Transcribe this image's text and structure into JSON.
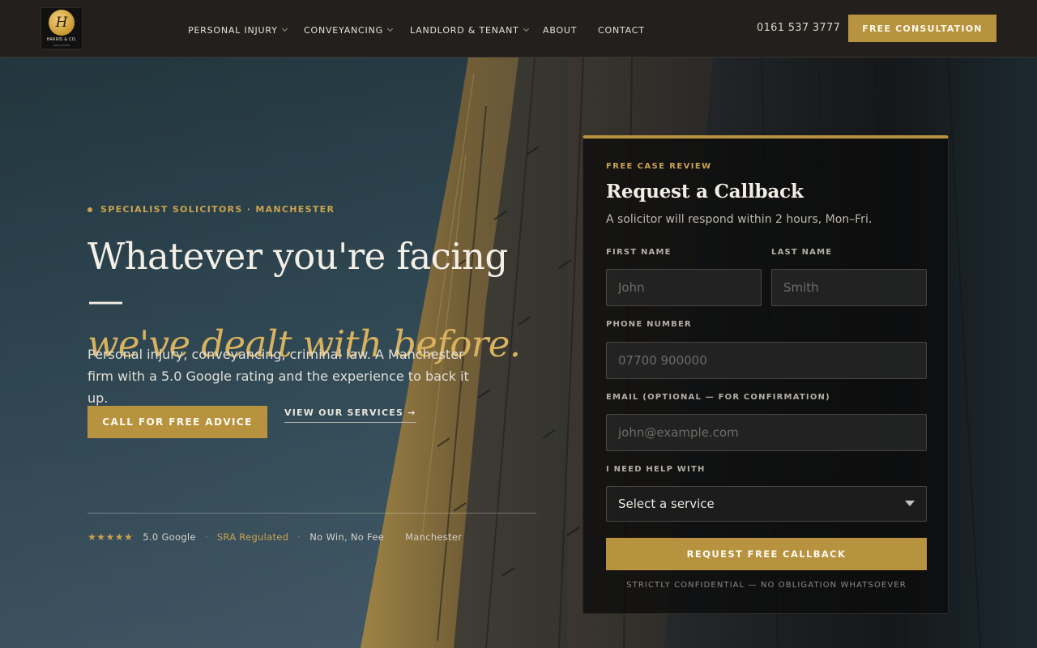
{
  "header": {
    "logo": {
      "monogram": "H",
      "name": "HARRIS & CO.",
      "tagline": "SOLICITORS"
    },
    "nav": [
      {
        "label": "PERSONAL INJURY",
        "has_dropdown": true
      },
      {
        "label": "CONVEYANCING",
        "has_dropdown": true
      },
      {
        "label": "LANDLORD & TENANT",
        "has_dropdown": true
      },
      {
        "label": "ABOUT",
        "has_dropdown": false
      },
      {
        "label": "CONTACT",
        "has_dropdown": false
      }
    ],
    "phone": "0161 537 3777",
    "cta_label": "FREE CONSULTATION"
  },
  "hero": {
    "eyebrow": "SPECIALIST SOLICITORS · MANCHESTER",
    "headline_line1": "Whatever you're facing —",
    "headline_line2": "we've dealt with before.",
    "lede": "Personal injury, conveyancing, criminal law. A Manchester firm with a 5.0 Google rating and the experience to back it up.",
    "primary_cta": "CALL FOR FREE ADVICE",
    "secondary_cta": "VIEW OUR SERVICES →",
    "trust": {
      "stars": "★★★★★",
      "rating": "5.0 Google",
      "regulated": "SRA Regulated",
      "fee": "No Win, No Fee",
      "location": "Manchester",
      "separator": "·"
    }
  },
  "form": {
    "eyebrow": "FREE CASE REVIEW",
    "title": "Request a Callback",
    "subtitle": "A solicitor will respond within 2 hours, Mon–Fri.",
    "first_name": {
      "label": "FIRST NAME",
      "placeholder": "John",
      "value": ""
    },
    "last_name": {
      "label": "LAST NAME",
      "placeholder": "Smith",
      "value": ""
    },
    "phone": {
      "label": "PHONE NUMBER",
      "placeholder": "07700 900000",
      "value": ""
    },
    "email": {
      "label": "EMAIL (OPTIONAL — FOR CONFIRMATION)",
      "placeholder": "john@example.com",
      "value": ""
    },
    "service": {
      "label": "I NEED HELP WITH",
      "selected": "Select a service"
    },
    "submit_label": "REQUEST FREE CALLBACK",
    "fineprint": "STRICTLY CONFIDENTIAL — NO OBLIGATION WHATSOEVER"
  },
  "colors": {
    "accent_gold": "#b7923f",
    "accent_gold_text": "#caa250",
    "header_bg": "#221f1c",
    "card_bg": "#0c0c0c"
  }
}
